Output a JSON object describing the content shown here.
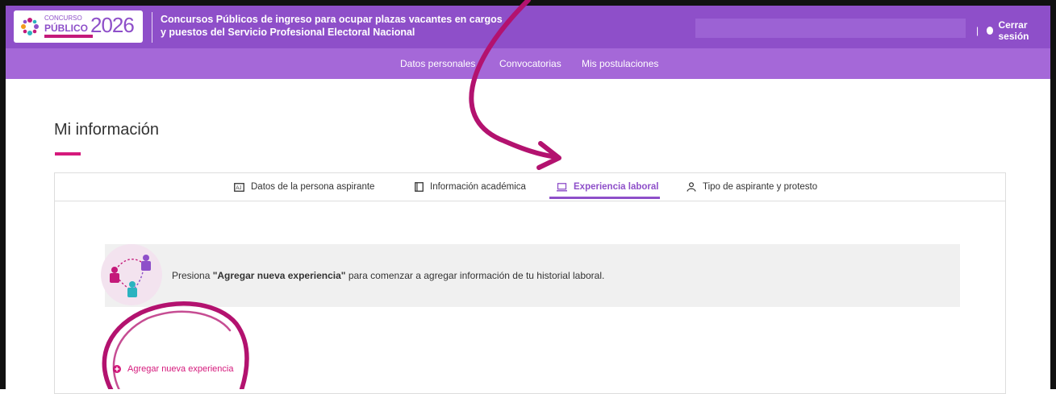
{
  "header": {
    "logo_small": "CONCURSO",
    "logo_main": "PÚBLICO",
    "logo_year": "2026",
    "title_line1": "Concursos Públicos de ingreso para ocupar plazas vacantes en cargos",
    "title_line2": "y puestos del Servicio Profesional Electoral Nacional",
    "separator": "|",
    "logout_label": "Cerrar sesión"
  },
  "nav": {
    "items": [
      {
        "label": "Datos personales"
      },
      {
        "label": "Convocatorias"
      },
      {
        "label": "Mis postulaciones"
      }
    ]
  },
  "page": {
    "title": "Mi información"
  },
  "tabs": [
    {
      "label": "Datos de la persona aspirante",
      "icon": "id-card-icon"
    },
    {
      "label": "Información académica",
      "icon": "book-icon"
    },
    {
      "label": "Experiencia laboral",
      "icon": "laptop-icon",
      "active": true
    },
    {
      "label": "Tipo de aspirante y protesto",
      "icon": "person-icon"
    }
  ],
  "message": {
    "prefix": "Presiona ",
    "emphasis": "\"Agregar nueva experiencia\"",
    "suffix": " para comenzar a agregar información de tu historial laboral."
  },
  "add_button": {
    "label": "Agregar nueva experiencia"
  },
  "colors": {
    "brand_purple": "#8e4fc9",
    "nav_purple": "#a568d8",
    "accent_magenta": "#d5197c",
    "annotation": "#b3126f"
  }
}
